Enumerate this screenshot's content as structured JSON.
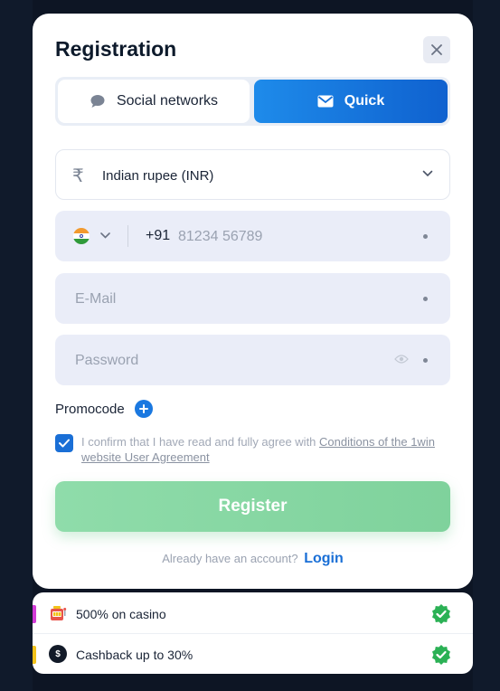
{
  "modal": {
    "title": "Registration"
  },
  "tabs": {
    "social_label": "Social networks",
    "quick_label": "Quick"
  },
  "currency": {
    "symbol": "₹",
    "selected": "Indian rupee (INR)"
  },
  "phone": {
    "country_code": "+91",
    "placeholder": "81234 56789"
  },
  "email": {
    "placeholder": "E-Mail"
  },
  "password": {
    "placeholder": "Password"
  },
  "promo": {
    "label": "Promocode"
  },
  "agreement": {
    "text": "I confirm that I have read and fully agree with ",
    "link": "Conditions of the 1win website User Agreement",
    "checked": true
  },
  "register": {
    "label": "Register"
  },
  "account": {
    "text": "Already have an account?",
    "login_label": "Login"
  },
  "bonuses": [
    {
      "icon": "slot-machine-icon",
      "label": "500% on casino",
      "marker_color": "#d13bd6"
    },
    {
      "icon": "cashback-money-icon",
      "label": "Cashback up to 30%",
      "icon_text": "$",
      "marker_color": "#f2c21a"
    }
  ],
  "colors": {
    "accent_blue": "#1a6fd6",
    "register_green": "#8fdcaa",
    "success_green": "#2bb155"
  }
}
